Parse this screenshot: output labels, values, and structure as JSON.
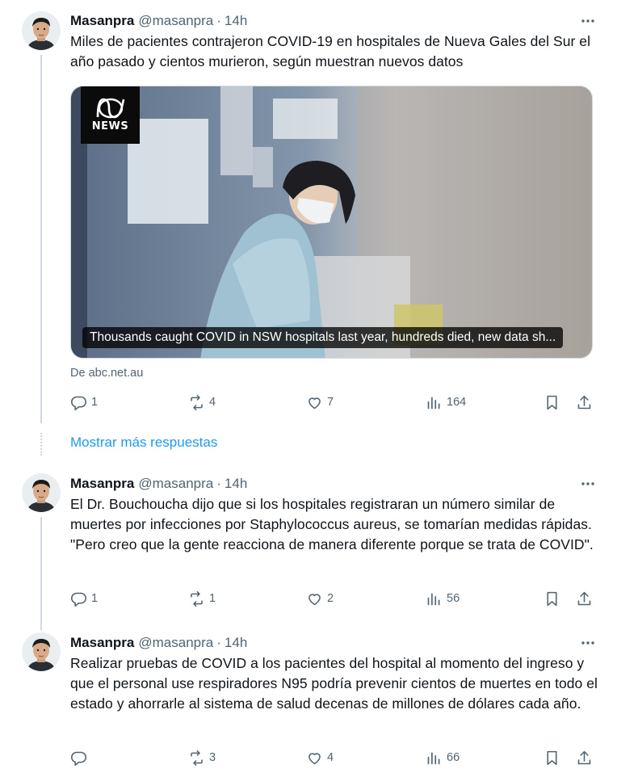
{
  "colors": {
    "text": "#0f1419",
    "muted": "#536471",
    "link": "#1d9bf0",
    "line": "#cfd9de"
  },
  "tweets": [
    {
      "name": "Masanpra",
      "handle": "@masanpra",
      "dot": "·",
      "time": "14h",
      "text": "Miles de pacientes contrajeron COVID-19 en hospitales de Nueva Gales del Sur el año pasado y cientos murieron, según muestran nuevos datos",
      "card": {
        "logo_text": "NEWS",
        "caption": "Thousands caught COVID in NSW hospitals last year, hundreds died, new data sh...",
        "source": "De abc.net.au"
      },
      "replies": "1",
      "reposts": "4",
      "likes": "7",
      "views": "164"
    },
    {
      "name": "Masanpra",
      "handle": "@masanpra",
      "dot": "·",
      "time": "14h",
      "text": "El Dr. Bouchoucha dijo que si los hospitales registraran un número similar de muertes por infecciones por Staphylococcus aureus, se tomarían medidas rápidas. \"Pero creo que la gente reacciona de manera diferente porque se trata de COVID\".",
      "replies": "1",
      "reposts": "1",
      "likes": "2",
      "views": "56"
    },
    {
      "name": "Masanpra",
      "handle": "@masanpra",
      "dot": "·",
      "time": "14h",
      "text": "Realizar pruebas de COVID a los pacientes del hospital al momento del ingreso y que el personal use respiradores N95 podría prevenir cientos de muertes en todo el estado y ahorrarle al sistema de salud decenas de millones de dólares cada año.",
      "replies": "",
      "reposts": "3",
      "likes": "4",
      "views": "66"
    }
  ],
  "show_more": "Mostrar más respuestas",
  "icons": [
    "more-icon",
    "reply-icon",
    "repost-icon",
    "like-icon",
    "views-icon",
    "bookmark-icon",
    "share-icon",
    "abc-logo-icon"
  ]
}
